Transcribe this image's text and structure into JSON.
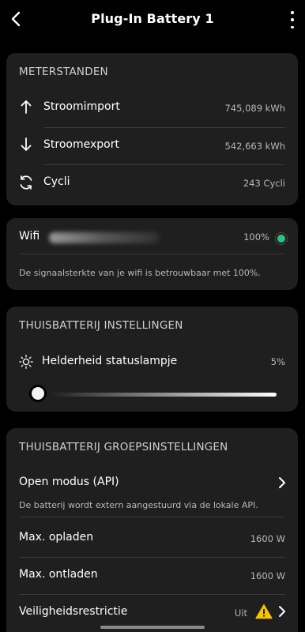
{
  "header": {
    "title": "Plug-In Battery 1"
  },
  "meters": {
    "section_title": "METERSTANDEN",
    "rows": [
      {
        "label": "Stroomimport",
        "value": "745,089 kWh",
        "icon": "arrow-up-icon"
      },
      {
        "label": "Stroomexport",
        "value": "542,663 kWh",
        "icon": "arrow-down-icon"
      },
      {
        "label": "Cycli",
        "value": "243 Cycli",
        "icon": "cycle-icon"
      }
    ]
  },
  "wifi": {
    "label": "Wifi",
    "value": "100%",
    "status_color": "#2ec27e",
    "note": "De signaalsterkte van je wifi is betrouwbaar met 100%."
  },
  "battery_settings": {
    "section_title": "THUISBATTERIJ INSTELLINGEN",
    "brightness_label": "Helderheid statuslampje",
    "brightness_value": "5%",
    "brightness_level": 0.05
  },
  "group_settings": {
    "section_title": "THUISBATTERIJ GROEPSINSTELLINGEN",
    "open_mode_label": "Open modus (API)",
    "open_mode_note": "De batterij wordt extern aangestuurd via de lokale API.",
    "max_charge_label": "Max. opladen",
    "max_charge_value": "1600 W",
    "max_discharge_label": "Max. ontladen",
    "max_discharge_value": "1600 W",
    "safety_label": "Veiligheidsrestrictie",
    "safety_value": "Uit",
    "warning_color": "#f5c400"
  }
}
